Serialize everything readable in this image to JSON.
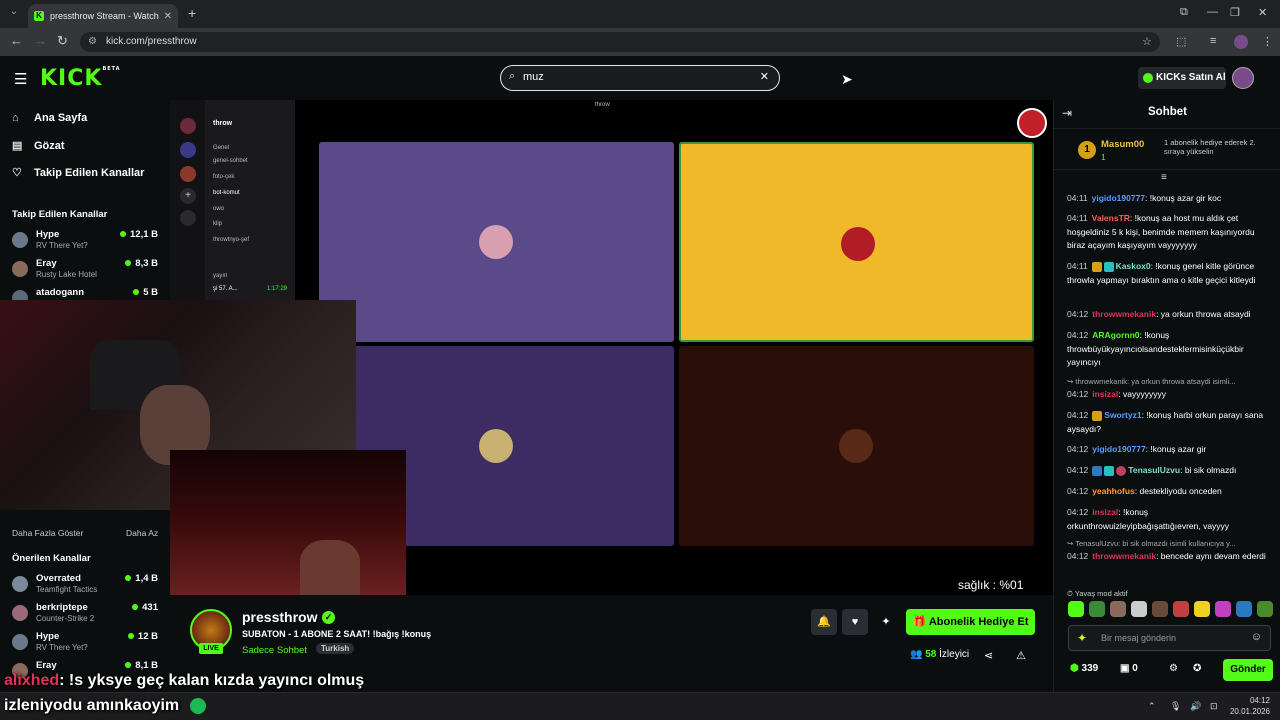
{
  "browser": {
    "tab_title": "pressthrow Stream - Watch Live",
    "url": "kick.com/pressthrow",
    "new_tab_label": "+"
  },
  "header": {
    "logo_text": "KICK",
    "logo_sup": "BETA",
    "search_value": "muz",
    "kicks_button": "KICKs Satın Al"
  },
  "sidebar": {
    "nav": [
      {
        "label": "Ana Sayfa",
        "icon": "home-icon"
      },
      {
        "label": "Gözat",
        "icon": "browse-icon"
      },
      {
        "label": "Takip Edilen Kanallar",
        "icon": "heart-icon"
      }
    ],
    "followed_title": "Takip Edilen Kanallar",
    "followed": [
      {
        "name": "Hype",
        "game": "RV There Yet?",
        "viewers": "12,1 B",
        "color": "#6a7a8a"
      },
      {
        "name": "Eray",
        "game": "Rusty Lake Hotel",
        "viewers": "8,3 B",
        "color": "#8a6a5a"
      },
      {
        "name": "atadogann",
        "game": "",
        "viewers": "5 B",
        "color": "#5a6a7a"
      }
    ],
    "show_more": "Daha Fazla Göster",
    "show_less": "Daha Az",
    "recommended_title": "Önerilen Kanallar",
    "recommended": [
      {
        "name": "Overrated",
        "game": "Teamfight Tactics",
        "viewers": "1,4 B",
        "color": "#7a8a9a"
      },
      {
        "name": "berkriptepe",
        "game": "Counter-Strike 2",
        "viewers": "431",
        "color": "#9a6a7a"
      },
      {
        "name": "Hype",
        "game": "RV There Yet?",
        "viewers": "12 B",
        "color": "#6a7a8a"
      },
      {
        "name": "Eray",
        "game": "",
        "viewers": "8,1 B",
        "color": "#8a6a5a"
      }
    ]
  },
  "stream": {
    "discord_server": "throw",
    "discord_window_title": "throw",
    "discord_channels": [
      "Genel",
      "genel-sohbet",
      "foto-çek",
      "bot-komut",
      "owo",
      "klip",
      "throwtnyo-şef",
      "yayın",
      "şi 57. A...",
      "1:17:29"
    ],
    "overlay_text": "sağlık : %01",
    "tile_colors": [
      "#5b4a8a",
      "#f0b92a",
      "#3d2c63",
      "#2a0e0a"
    ]
  },
  "info": {
    "streamer": "pressthrow",
    "title": "SUBATON - 1 ABONE 2 SAAT! !bağış !konuş",
    "category": "Sadece Sohbet",
    "tag": "Turkish",
    "live": "LIVE",
    "gift_button": "Abonelik Hediye Et",
    "viewers": "58",
    "viewers_label": "İzleyici"
  },
  "chat": {
    "title": "Sohbet",
    "pinned": {
      "rank": "1",
      "name": "Masum00",
      "count": "1",
      "desc": "1 abonelik hediye ederek 2. sıraya yükselin"
    },
    "messages": [
      {
        "time": "04:11",
        "user": "yigido190777",
        "color": "#5b9bff",
        "text": "!konuş azar gir koc"
      },
      {
        "time": "04:11",
        "user": "ValensTR",
        "color": "#ff5a5a",
        "text": "!konuş aa host mu aldık çet hoşgeldiniz 5 k kişi, benimde memem kaşınıyordu biraz açayım kaşıyayım vayyyyyyy"
      },
      {
        "time": "04:11",
        "user": "Kaskox0",
        "color": "#7ee0c8",
        "text": "!konuş genel kitle görünce throwla yapmayı bıraktın ama o kitle geçici kitleydi"
      },
      {
        "time": "04:12",
        "user": "throwwmekanik",
        "color": "#e0315a",
        "text": "ya orkun throwa atsaydi"
      },
      {
        "time": "04:12",
        "user": "ARAgornn0",
        "color": "#53fc18",
        "text": "!konuş throwbüyükyayıncıolsandesteklermisinküçükbir yayıncıyı"
      },
      {
        "time": "04:12",
        "user": "insizal",
        "color": "#e0315a",
        "text": "vayyyyyyyy"
      },
      {
        "time": "04:12",
        "user": "Swortyz1",
        "color": "#5b9bff",
        "text": "!konuş harbi orkun parayı sana aysaydı?"
      },
      {
        "time": "04:12",
        "user": "yigido190777",
        "color": "#5b9bff",
        "text": "!konuş azar gir"
      },
      {
        "time": "04:12",
        "user": "TenasulUzvu",
        "color": "#7ee0c8",
        "text": "bi sik olmazdı"
      },
      {
        "time": "04:12",
        "user": "yeahhofus",
        "color": "#ff9a3a",
        "text": "destekliyodu onceden"
      },
      {
        "time": "04:12",
        "user": "insizal",
        "color": "#e0315a",
        "text": "!konuş orkunthrowuizleyipbağışattığıevren, vayyyy"
      },
      {
        "time": "04:12",
        "user": "throwwmekanik",
        "color": "#e0315a",
        "text": "bencede aynı devam ederdi"
      }
    ],
    "replies": [
      "throwwmekanik: ya orkun throwa atsaydi isimli...",
      "TenasulUzvu: bi sik olmazdı isimli kullanıcıya y..."
    ],
    "slow_mode": "Yavaş mod aktif",
    "input_placeholder": "Bir mesaj gönderin",
    "points": "339",
    "gifts": "0",
    "send": "Gönder"
  },
  "captions": {
    "line1_name": "alixhed",
    "line1_text": ": !s yksye geç kalan kızda yayıncı olmuş",
    "line2": "izleniyodu amınkaoyim"
  },
  "taskbar": {
    "time": "04:12",
    "date": "20.01.2026"
  }
}
